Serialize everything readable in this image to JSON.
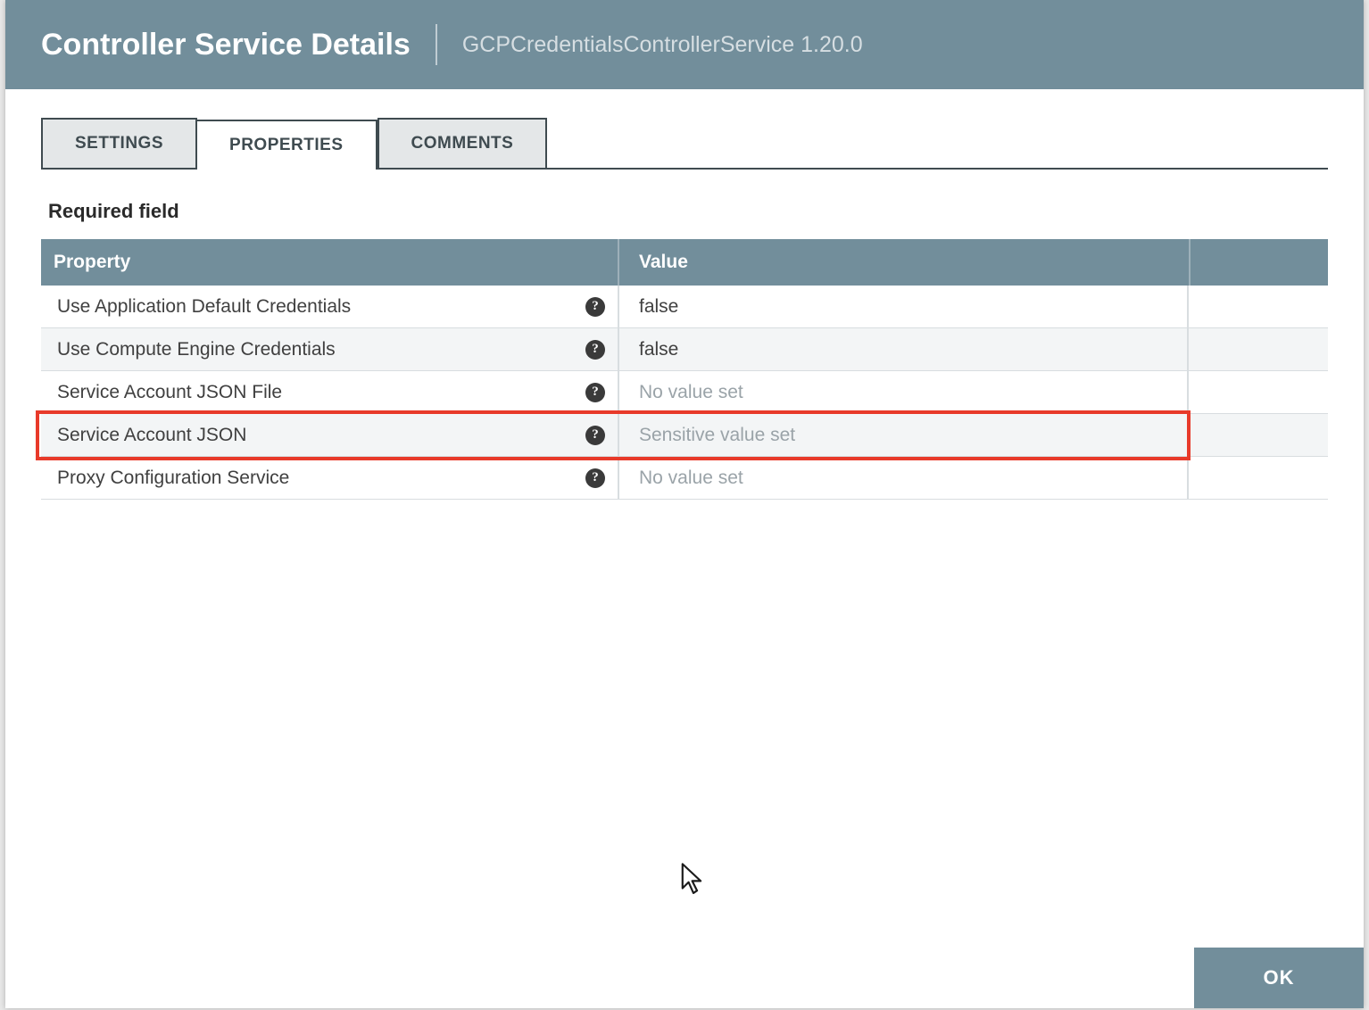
{
  "header": {
    "title": "Controller Service Details",
    "subtitle": "GCPCredentialsControllerService 1.20.0"
  },
  "tabs": [
    {
      "label": "SETTINGS",
      "active": false
    },
    {
      "label": "PROPERTIES",
      "active": true
    },
    {
      "label": "COMMENTS",
      "active": false
    }
  ],
  "section_label": "Required field",
  "table": {
    "headers": {
      "property": "Property",
      "value": "Value"
    },
    "rows": [
      {
        "name": "Use Application Default Credentials",
        "value": "false",
        "muted": false
      },
      {
        "name": "Use Compute Engine Credentials",
        "value": "false",
        "muted": false
      },
      {
        "name": "Service Account JSON File",
        "value": "No value set",
        "muted": true
      },
      {
        "name": "Service Account JSON",
        "value": "Sensitive value set",
        "muted": true,
        "highlighted": true
      },
      {
        "name": "Proxy Configuration Service",
        "value": "No value set",
        "muted": true
      }
    ]
  },
  "footer": {
    "ok_label": "OK"
  },
  "help_glyph": "?"
}
